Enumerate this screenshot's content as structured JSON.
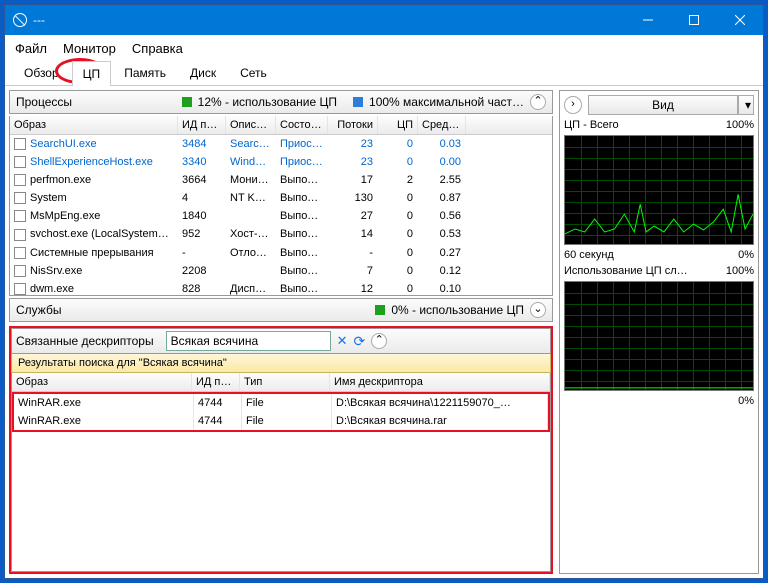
{
  "window": {
    "title": "---"
  },
  "menubar": [
    "Файл",
    "Монитор",
    "Справка"
  ],
  "tabs": [
    "Обзор",
    "ЦП",
    "Память",
    "Диск",
    "Сеть"
  ],
  "active_tab": 1,
  "processes_panel": {
    "title": "Процессы",
    "usage_label": "12% - использование ЦП",
    "max_label": "100% максимальной част…",
    "usage_color": "#1ea01e",
    "max_color": "#2d7cd6",
    "columns": [
      "Образ",
      "ИД п…",
      "Описа…",
      "Состоя…",
      "Потоки",
      "ЦП",
      "Средн…"
    ],
    "rows": [
      {
        "image": "SearchUI.exe",
        "pid": "3484",
        "desc": "Search …",
        "status": "Приос…",
        "threads": "23",
        "cpu": "0",
        "avg": "0.03",
        "link": true
      },
      {
        "image": "ShellExperienceHost.exe",
        "pid": "3340",
        "desc": "Windo…",
        "status": "Приос…",
        "threads": "23",
        "cpu": "0",
        "avg": "0.00",
        "link": true
      },
      {
        "image": "perfmon.exe",
        "pid": "3664",
        "desc": "Монит…",
        "status": "Выпол…",
        "threads": "17",
        "cpu": "2",
        "avg": "2.55"
      },
      {
        "image": "System",
        "pid": "4",
        "desc": "NT Ker…",
        "status": "Выпол…",
        "threads": "130",
        "cpu": "0",
        "avg": "0.87"
      },
      {
        "image": "MsMpEng.exe",
        "pid": "1840",
        "desc": "",
        "status": "Выпол…",
        "threads": "27",
        "cpu": "0",
        "avg": "0.56"
      },
      {
        "image": "svchost.exe (LocalSystemNet…",
        "pid": "952",
        "desc": "Хост-п…",
        "status": "Выпол…",
        "threads": "14",
        "cpu": "0",
        "avg": "0.53"
      },
      {
        "image": "Системные прерывания",
        "pid": "-",
        "desc": "Отлож…",
        "status": "Выпол…",
        "threads": "-",
        "cpu": "0",
        "avg": "0.27"
      },
      {
        "image": "NisSrv.exe",
        "pid": "2208",
        "desc": "",
        "status": "Выпол…",
        "threads": "7",
        "cpu": "0",
        "avg": "0.12"
      },
      {
        "image": "dwm.exe",
        "pid": "828",
        "desc": "Диспе…",
        "status": "Выпол…",
        "threads": "12",
        "cpu": "0",
        "avg": "0.10"
      }
    ]
  },
  "services_panel": {
    "title": "Службы",
    "usage_label": "0% - использование ЦП",
    "usage_color": "#1ea01e"
  },
  "descriptors_panel": {
    "title": "Связанные дескрипторы",
    "search_value": "Всякая всячина",
    "results_header": "Результаты поиска для \"Всякая всячина\"",
    "columns": [
      "Образ",
      "ИД п…",
      "Тип",
      "Имя дескриптора"
    ],
    "rows": [
      {
        "image": "WinRAR.exe",
        "pid": "4744",
        "type": "File",
        "name": "D:\\Всякая всячина\\1221159070_…"
      },
      {
        "image": "WinRAR.exe",
        "pid": "4744",
        "type": "File",
        "name": "D:\\Всякая всячина.rar"
      }
    ]
  },
  "right_panel": {
    "view_label": "Вид",
    "chart1": {
      "title": "ЦП - Всего",
      "max": "100%",
      "bottom_left": "60 секунд",
      "bottom_right": "0%"
    },
    "chart2": {
      "title": "Использование ЦП сл…",
      "max": "100%",
      "bottom_left": "",
      "bottom_right": "0%"
    }
  }
}
